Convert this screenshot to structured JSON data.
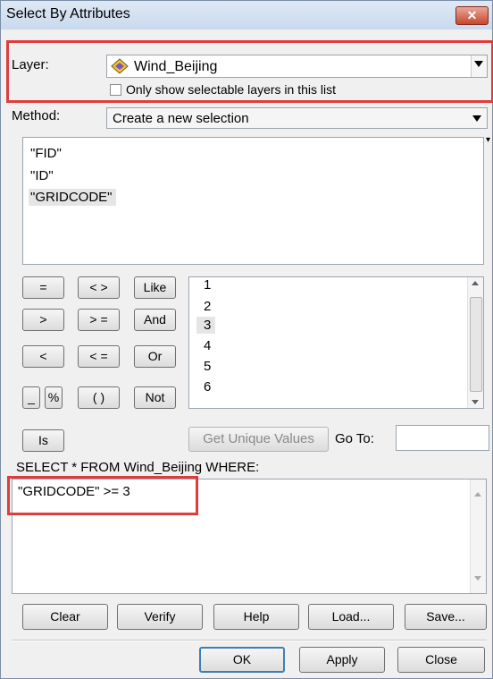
{
  "window": {
    "title": "Select By Attributes",
    "close_glyph": "✕"
  },
  "layer": {
    "label": "Layer:",
    "value": "Wind_Beijing",
    "only_selectable": "Only show selectable layers in this list"
  },
  "method": {
    "label": "Method:",
    "value": "Create a new selection"
  },
  "fields": [
    "\"FID\"",
    "\"ID\"",
    "\"GRIDCODE\""
  ],
  "operators": {
    "eq": "=",
    "ne": "< >",
    "like": "Like",
    "gt": ">",
    "ge": "> =",
    "and": "And",
    "lt": "<",
    "le": "< =",
    "or": "Or",
    "underscore": "_",
    "percent": "%",
    "parens": "( )",
    "not": "Not",
    "is": "Is"
  },
  "values": [
    "1",
    "2",
    "3",
    "4",
    "5",
    "6"
  ],
  "get_unique": "Get Unique Values",
  "goto": {
    "label": "Go To:",
    "value": ""
  },
  "where_label": "SELECT * FROM Wind_Beijing WHERE:",
  "expression": "\"GRIDCODE\" >=  3",
  "buttons": {
    "clear": "Clear",
    "verify": "Verify",
    "help": "Help",
    "load": "Load...",
    "save": "Save...",
    "ok": "OK",
    "apply": "Apply",
    "close": "Close"
  },
  "colors": {
    "highlight": "#e03c3c",
    "accent": "#3c7fb1"
  }
}
